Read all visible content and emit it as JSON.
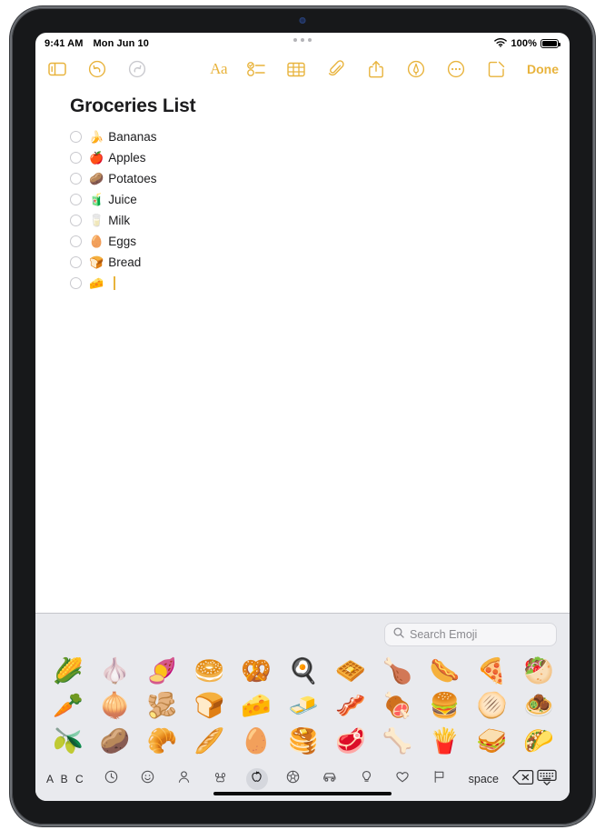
{
  "status_bar": {
    "time": "9:41 AM",
    "date": "Mon Jun 10",
    "battery_percent": "100%",
    "wifi_icon": "wifi-icon",
    "battery_icon": "battery-full-icon"
  },
  "toolbar": {
    "left_items": [
      {
        "name": "sidebar-toggle-button",
        "icon": "sidebar-icon",
        "state": "enabled"
      },
      {
        "name": "undo-button",
        "icon": "undo-arrow-icon",
        "state": "enabled"
      },
      {
        "name": "redo-button",
        "icon": "redo-arrow-icon",
        "state": "disabled"
      }
    ],
    "right_items": [
      {
        "name": "format-button",
        "icon": "aa-format-icon",
        "label": "Aa"
      },
      {
        "name": "checklist-button",
        "icon": "checklist-icon"
      },
      {
        "name": "table-button",
        "icon": "table-icon"
      },
      {
        "name": "attachment-button",
        "icon": "paperclip-icon"
      },
      {
        "name": "share-button",
        "icon": "share-icon"
      },
      {
        "name": "markup-button",
        "icon": "markup-pen-icon"
      },
      {
        "name": "more-button",
        "icon": "ellipsis-circle-icon"
      },
      {
        "name": "compose-button",
        "icon": "compose-icon"
      }
    ],
    "done_label": "Done",
    "accent_color": "#e8b33c",
    "disabled_color": "#c9c9ce"
  },
  "note": {
    "title": "Groceries List",
    "checklist": [
      {
        "emoji": "🍌",
        "label": "Bananas",
        "checked": false
      },
      {
        "emoji": "🍎",
        "label": "Apples",
        "checked": false
      },
      {
        "emoji": "🥔",
        "label": "Potatoes",
        "checked": false
      },
      {
        "emoji": "🧃",
        "label": "Juice",
        "checked": false
      },
      {
        "emoji": "🥛",
        "label": "Milk",
        "checked": false
      },
      {
        "emoji": "🥚",
        "label": "Eggs",
        "checked": false
      },
      {
        "emoji": "🍞",
        "label": "Bread",
        "checked": false
      },
      {
        "emoji": "🧀",
        "label": "",
        "checked": false,
        "has_caret": true
      }
    ]
  },
  "keyboard": {
    "search": {
      "placeholder": "Search Emoji",
      "icon": "search-icon"
    },
    "emoji_grid": [
      "🌽",
      "🧄",
      "🍠",
      "🥯",
      "🥨",
      "🍳",
      "🧇",
      "🍗",
      "🌭",
      "🍕",
      "🥙",
      "🥕",
      "🧅",
      "🫚",
      "🍞",
      "🧀",
      "🧈",
      "🥓",
      "🍖",
      "🍔",
      "🫓",
      "🧆",
      "🫒",
      "🥔",
      "🥐",
      "🥖",
      "🥚",
      "🥞",
      "🥩",
      "🦴",
      "🍟",
      "🥪",
      "🌮"
    ],
    "abc_label": "A B C",
    "space_label": "space",
    "categories": [
      {
        "name": "category-recents",
        "icon": "clock-icon",
        "selected": false
      },
      {
        "name": "category-smileys",
        "icon": "smiley-icon",
        "selected": false
      },
      {
        "name": "category-people",
        "icon": "person-icon",
        "selected": false
      },
      {
        "name": "category-animals",
        "icon": "paw-icon",
        "selected": false
      },
      {
        "name": "category-food",
        "icon": "apple-icon",
        "selected": true
      },
      {
        "name": "category-activity",
        "icon": "ball-icon",
        "selected": false
      },
      {
        "name": "category-travel",
        "icon": "car-icon",
        "selected": false
      },
      {
        "name": "category-objects",
        "icon": "lightbulb-icon",
        "selected": false
      },
      {
        "name": "category-symbols",
        "icon": "heart-icon",
        "selected": false
      },
      {
        "name": "category-flags",
        "icon": "flag-icon",
        "selected": false
      }
    ],
    "delete_icon": "delete-backward-icon",
    "dismiss_icon": "keyboard-dismiss-icon",
    "background_color": "#e9eaee"
  }
}
